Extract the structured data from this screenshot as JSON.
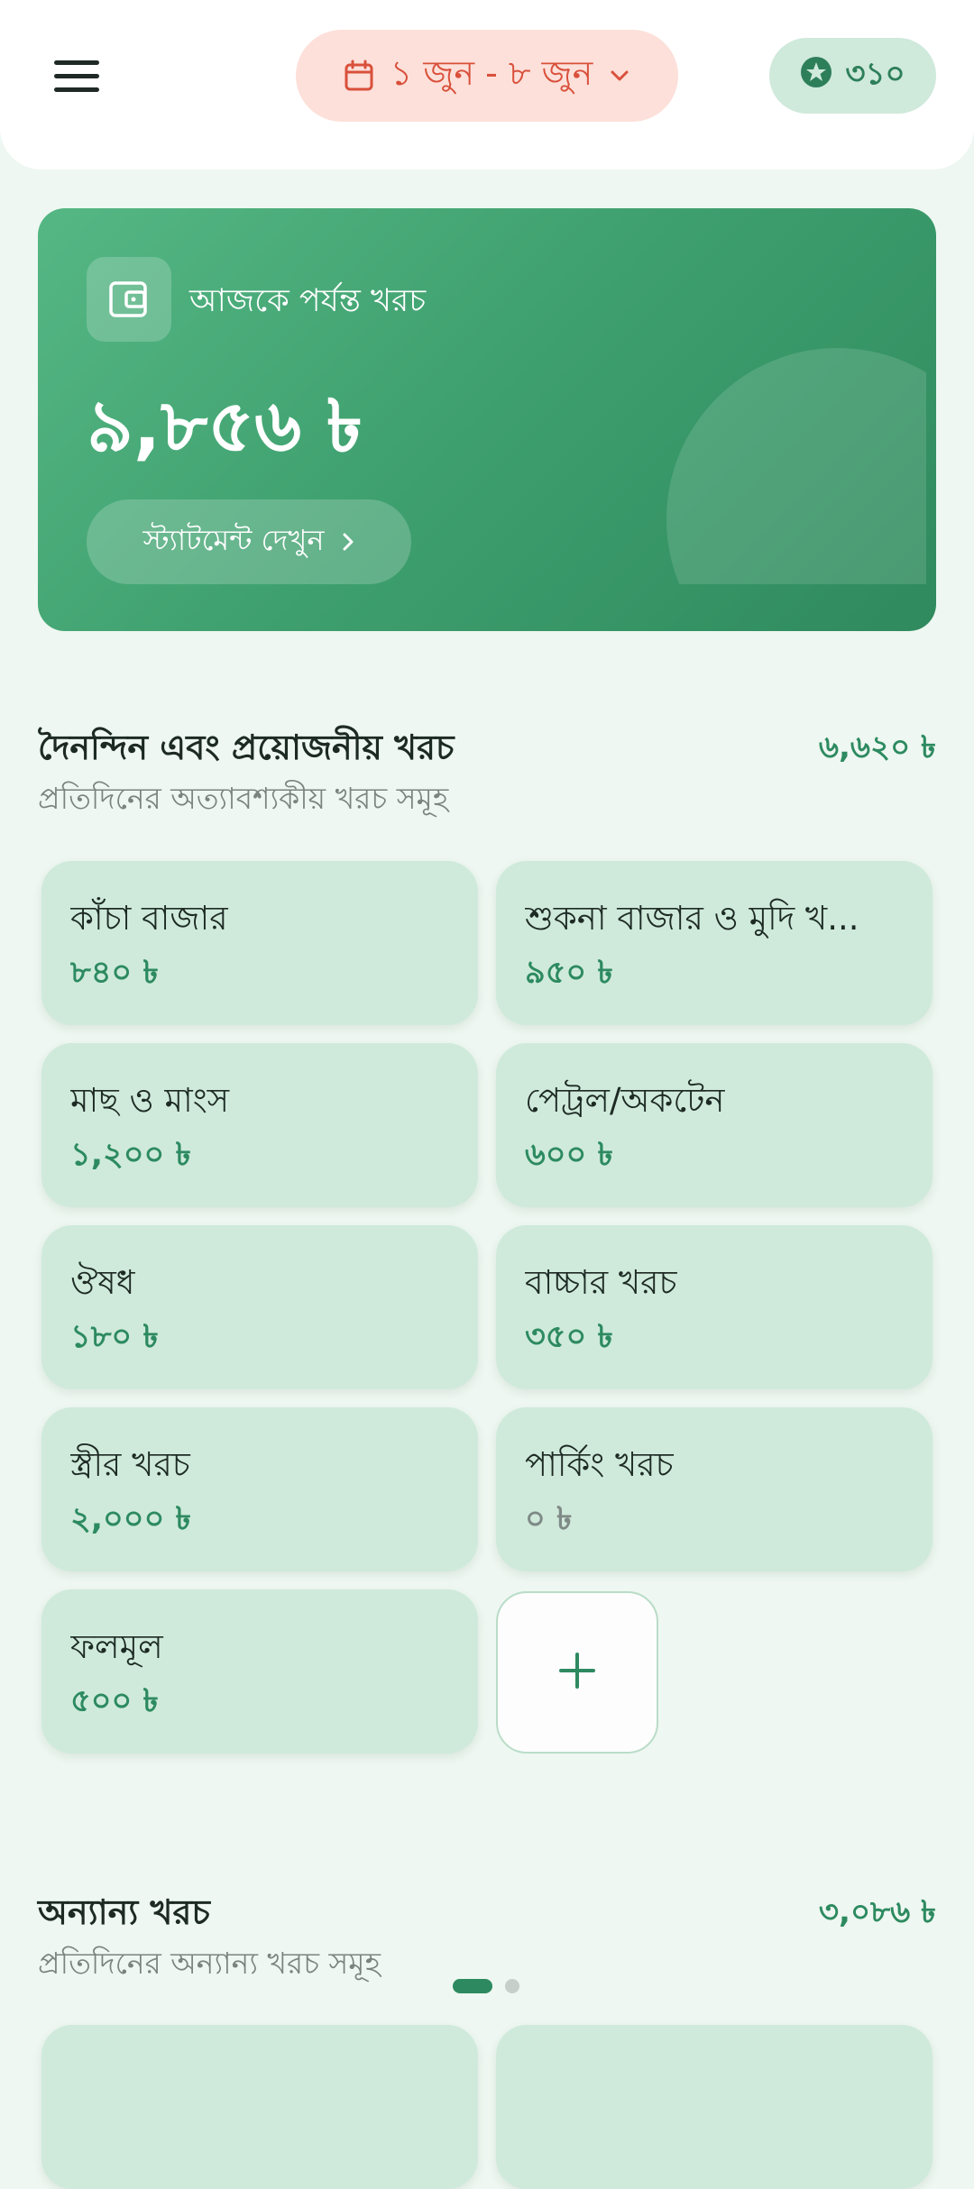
{
  "header": {
    "date_range": "১ জুন - ৮ জুন",
    "points": "৩১০"
  },
  "summary": {
    "label": "আজকে পর্যন্ত খরচ",
    "amount": "৯,৮৫৬ ৳",
    "statement_button": "স্ট্যাটমেন্ট দেখুন"
  },
  "daily_section": {
    "title": "দৈনন্দিন এবং প্রয়োজনীয় খরচ",
    "subtitle": "প্রতিদিনের অত্যাবশ্যকীয় খরচ সমূহ",
    "total": "৬,৬২০ ৳",
    "items": [
      {
        "name": "কাঁচা বাজার",
        "amount": "৮৪০ ৳"
      },
      {
        "name": "শুকনা বাজার ও মুদি খ...",
        "amount": "৯৫০ ৳"
      },
      {
        "name": "মাছ ও মাংস",
        "amount": "১,২০০ ৳"
      },
      {
        "name": "পেট্রল/অকটেন",
        "amount": "৬০০ ৳"
      },
      {
        "name": "ঔষধ",
        "amount": "১৮০ ৳"
      },
      {
        "name": "বাচ্চার খরচ",
        "amount": "৩৫০ ৳"
      },
      {
        "name": "স্ত্রীর খরচ",
        "amount": "২,০০০ ৳"
      },
      {
        "name": "পার্কিং খরচ",
        "amount": "০ ৳"
      },
      {
        "name": "ফলমূল",
        "amount": "৫০০ ৳"
      }
    ],
    "add_label": "+"
  },
  "other_section": {
    "title": "অন্যান্য খরচ",
    "subtitle": "প্রতিদিনের অন্যান্য খরচ সমূহ",
    "total": "৩,০৮৬ ৳"
  },
  "colors": {
    "accent": "#2d8a60",
    "date_pill_bg": "#fde0da",
    "date_pill_text": "#d9503b",
    "card_bg": "#cfeadb",
    "page_bg": "#eef7f1"
  },
  "icons": [
    "menu-icon",
    "calendar-icon",
    "chevron-down-icon",
    "star-icon",
    "wallet-icon",
    "chevron-right-icon",
    "plus-icon"
  ]
}
